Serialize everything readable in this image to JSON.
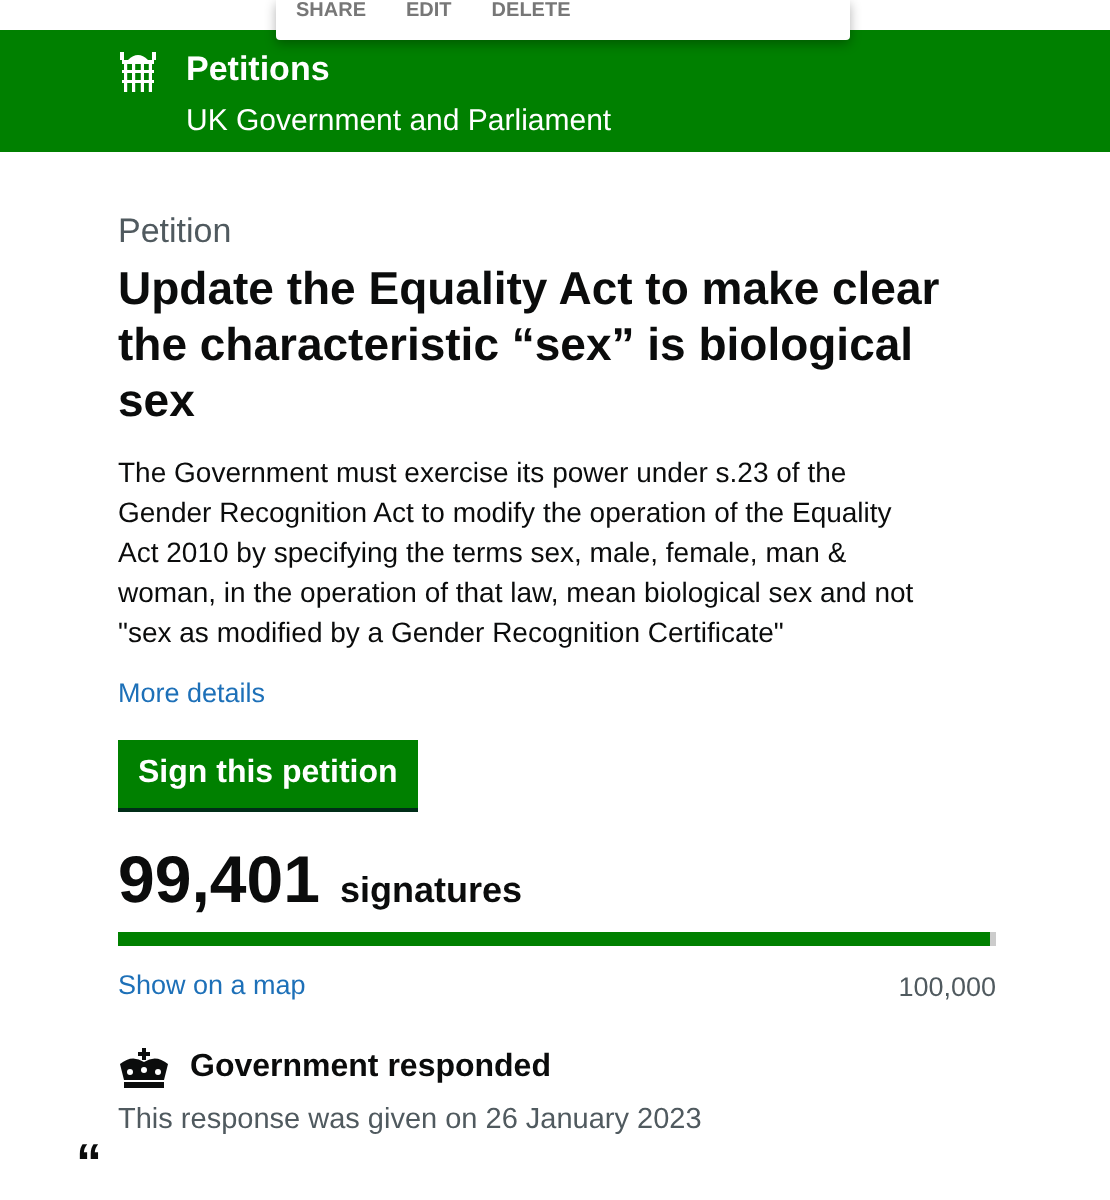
{
  "popup_menu": {
    "items": [
      "SHARE",
      "EDIT",
      "DELETE"
    ]
  },
  "header": {
    "title": "Petitions",
    "subtitle": "UK Government and Parliament"
  },
  "petition": {
    "label": "Petition",
    "title": "Update the Equality Act to make clear the characteristic “sex” is biological sex",
    "description": "The Government must exercise its power under s.23 of the Gender Recognition Act to modify the operation of the Equality Act 2010 by specifying the terms sex, male, female, man & woman, in the operation of that law, mean biological sex and not \"sex as modified by a Gender Recognition Certificate\"",
    "more_link": "More details",
    "sign_button": "Sign this petition"
  },
  "signatures": {
    "count": "99,401",
    "label": "signatures",
    "level": 0.994,
    "map_link": "Show on a map",
    "target": "100,000"
  },
  "response": {
    "title": "Government responded",
    "date_text": "This response was given on 26 January 2023",
    "quote_mark": "“"
  }
}
